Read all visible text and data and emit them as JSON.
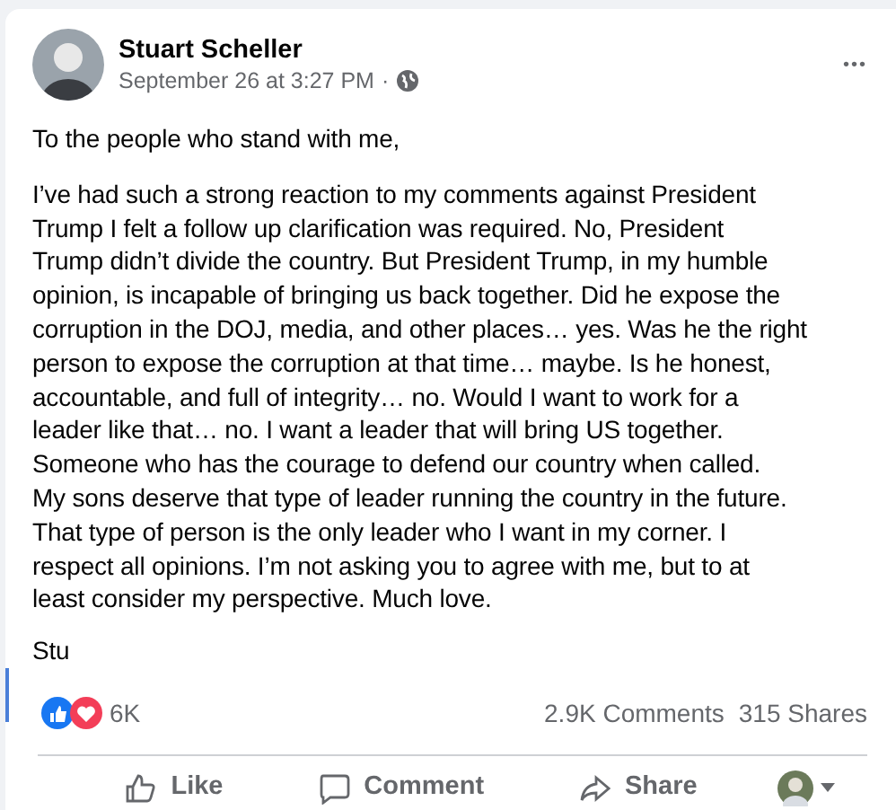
{
  "post": {
    "author": "Stuart Scheller",
    "time": "September 26 at 3:27 PM",
    "separator": "·",
    "more": "•••",
    "greeting": "To the people who stand with me,",
    "body_lines": [
      "I’ve had such a strong reaction to my comments against President",
      "Trump I felt a follow up clarification was required.  No, President",
      "Trump didn’t divide the country.  But President Trump, in my humble",
      "opinion, is incapable of bringing us back together.  Did he expose the",
      "corruption in the DOJ, media, and other places… yes.  Was he the right",
      "person to expose the corruption at that time… maybe.  Is he honest,",
      "accountable, and full of integrity… no.  Would I want to work for a",
      "leader like that… no.  I want a leader that will bring US together.",
      "Someone who has the courage to defend our country when called.",
      "My sons deserve that type of leader running the country in the future.",
      "That type of person is the only leader who I want in my corner.  I",
      "respect all opinions.  I’m not asking you to agree with me, but to at",
      "least consider my perspective.  Much love."
    ],
    "signature": "Stu"
  },
  "stats": {
    "reactions": [
      {
        "kind": "like",
        "color": "#1877f2"
      },
      {
        "kind": "love",
        "color": "#f33e58"
      }
    ],
    "reaction_count": "6K",
    "comments": "2.9K Comments",
    "shares": "315 Shares"
  },
  "actions": [
    {
      "kind": "like",
      "label": "Like"
    },
    {
      "kind": "comment",
      "label": "Comment"
    },
    {
      "kind": "share",
      "label": "Share"
    }
  ]
}
